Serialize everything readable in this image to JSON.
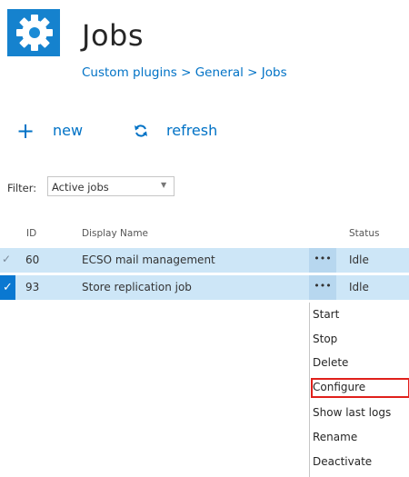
{
  "header": {
    "title": "Jobs",
    "breadcrumb": "Custom plugins > General > Jobs",
    "icon": "gear-icon"
  },
  "toolbar": {
    "new_label": "new",
    "refresh_label": "refresh"
  },
  "filter": {
    "label": "Filter:",
    "value": "Active jobs"
  },
  "table": {
    "columns": [
      "ID",
      "Display Name",
      "Status"
    ],
    "rows": [
      {
        "id": "60",
        "name": "ECSO mail management",
        "status": "Idle",
        "more": "•••"
      },
      {
        "id": "93",
        "name": "Store replication job",
        "status": "Idle",
        "more": "•••"
      }
    ]
  },
  "context_menu": {
    "items": [
      "Start",
      "Stop",
      "Delete",
      "Configure",
      "Show last logs",
      "Rename",
      "Deactivate"
    ],
    "highlighted": "Configure"
  },
  "colors": {
    "accent": "#0072c6",
    "selected_row": "#cde6f7",
    "highlight_border": "#e0201b"
  }
}
